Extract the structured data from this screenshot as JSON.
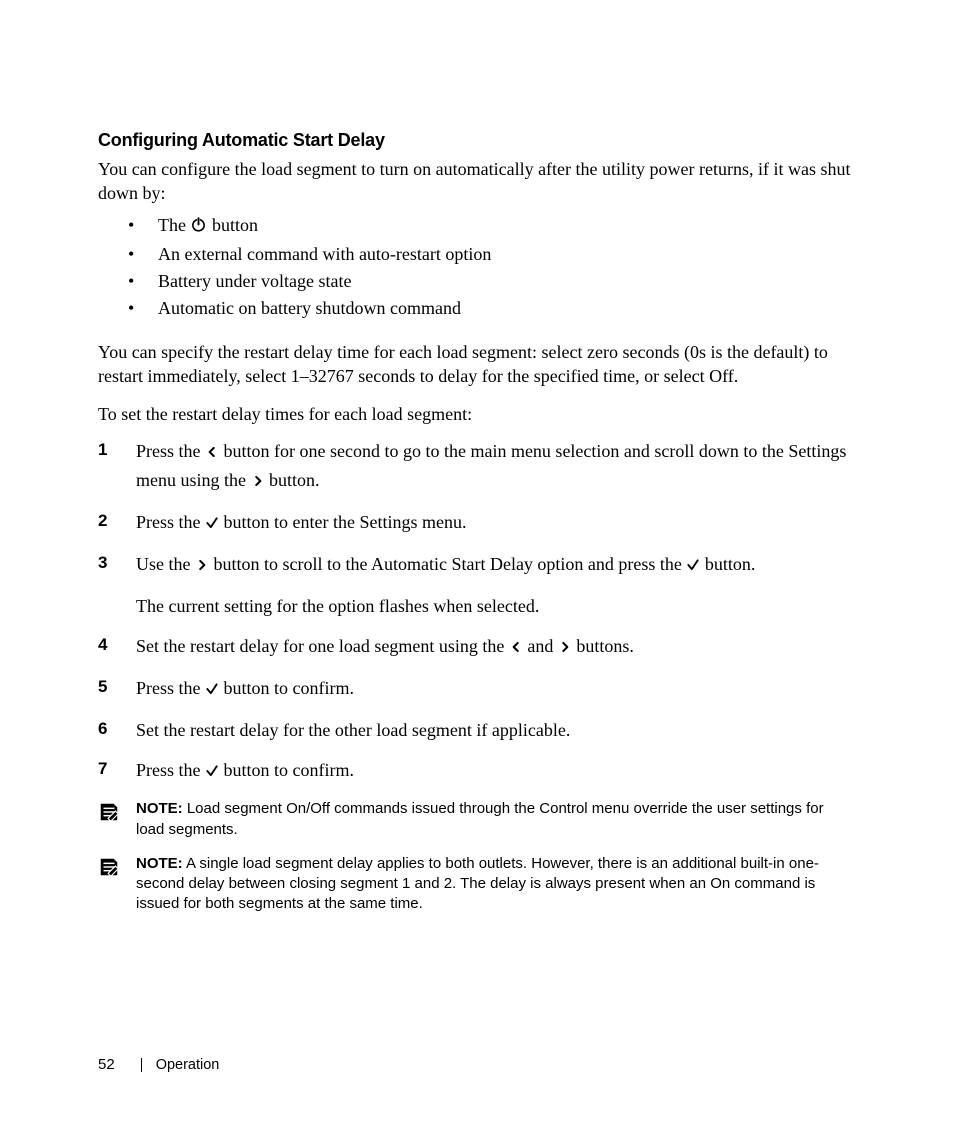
{
  "heading": "Configuring Automatic Start Delay",
  "intro": "You can configure the load segment to turn on automatically after the utility power returns, if it was shut down by:",
  "bullets": [
    {
      "prefix": "The ",
      "icon": "power",
      "suffix": " button"
    },
    {
      "text": "An external command with auto-restart option"
    },
    {
      "text": "Battery under voltage state"
    },
    {
      "text": "Automatic on battery shutdown command"
    }
  ],
  "para2": "You can specify the restart delay time for each load segment: select zero seconds (0s is the default) to restart immediately, select 1–32767 seconds to delay for the specified time, or select Off.",
  "para3": "To set the restart delay times for each load segment:",
  "steps": [
    {
      "parts": [
        {
          "t": "Press the "
        },
        {
          "icon": "left"
        },
        {
          "t": " button for one second to go to the main menu selection and scroll down to the Settings menu using the "
        },
        {
          "icon": "right"
        },
        {
          "t": " button."
        }
      ]
    },
    {
      "parts": [
        {
          "t": "Press the "
        },
        {
          "icon": "check"
        },
        {
          "t": " button to enter the Settings menu."
        }
      ]
    },
    {
      "parts": [
        {
          "t": "Use the "
        },
        {
          "icon": "right"
        },
        {
          "t": " button to scroll to the Automatic Start Delay option and press the "
        },
        {
          "icon": "check"
        },
        {
          "t": " button."
        }
      ],
      "sub": "The current setting for the option flashes when selected."
    },
    {
      "parts": [
        {
          "t": "Set the restart delay for one load segment using the "
        },
        {
          "icon": "left"
        },
        {
          "t": " and "
        },
        {
          "icon": "right"
        },
        {
          "t": " buttons."
        }
      ]
    },
    {
      "parts": [
        {
          "t": "Press the "
        },
        {
          "icon": "check"
        },
        {
          "t": " button to confirm."
        }
      ]
    },
    {
      "parts": [
        {
          "t": "Set the restart delay for the other load segment if applicable."
        }
      ]
    },
    {
      "parts": [
        {
          "t": "Press the "
        },
        {
          "icon": "check"
        },
        {
          "t": " button to confirm."
        }
      ]
    }
  ],
  "notes": [
    {
      "label": "NOTE:",
      "text": " Load segment On/Off commands issued through the Control menu override the user settings for load segments."
    },
    {
      "label": "NOTE:",
      "text": " A single load segment delay applies to both outlets. However, there is an additional built-in one-second delay between closing segment 1 and 2. The delay is always present when an On command is issued for both segments at the same time."
    }
  ],
  "footer": {
    "page": "52",
    "section": "Operation"
  }
}
